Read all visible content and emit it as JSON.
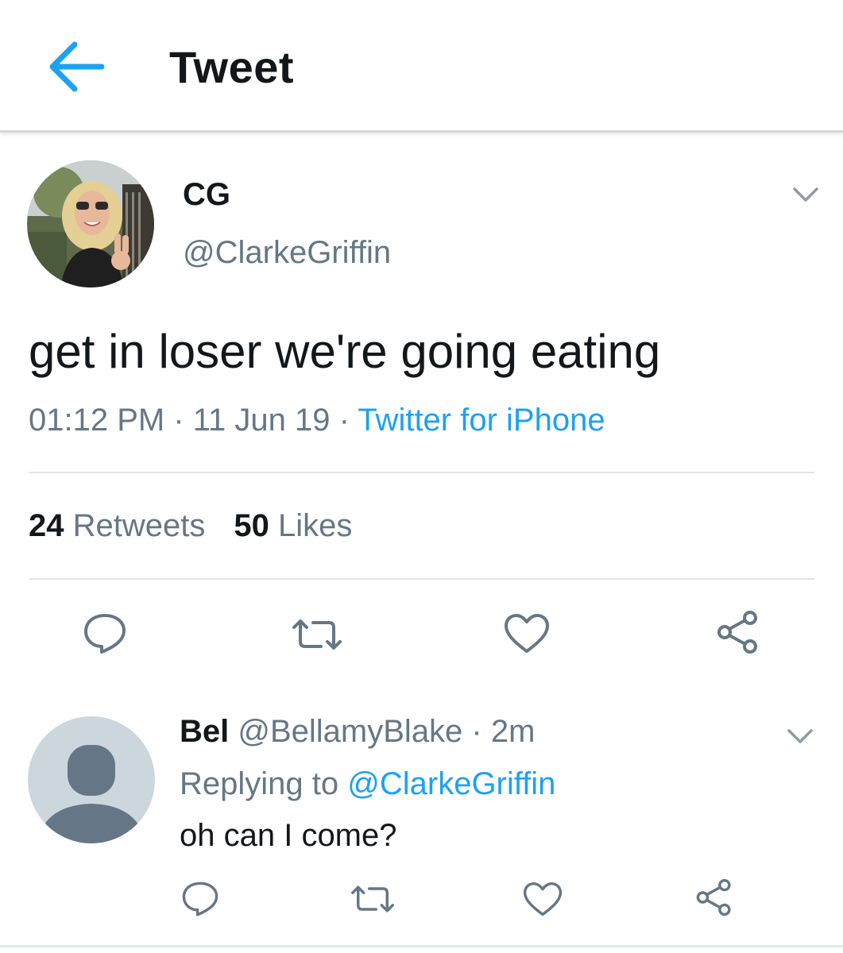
{
  "header": {
    "title": "Tweet"
  },
  "tweet": {
    "author_name": "CG",
    "author_handle": "@ClarkeGriffin",
    "text": "get in loser we're going eating",
    "time": "01:12 PM",
    "date": "11 Jun 19",
    "separator": " · ",
    "source": "Twitter for iPhone",
    "retweets_count": "24",
    "retweets_label": "Retweets",
    "likes_count": "50",
    "likes_label": "Likes"
  },
  "reply": {
    "author_name": "Bel",
    "author_handle": "@BellamyBlake",
    "time_sep": " · ",
    "time": "2m",
    "replying_prefix": "Replying to",
    "replying_to": "@ClarkeGriffin",
    "text": "oh can I come?"
  },
  "icons": {
    "back": "arrow-left-icon",
    "caret": "chevron-down-icon",
    "reply": "reply-bubble-icon",
    "retweet": "retweet-icon",
    "like": "heart-icon",
    "share": "share-icon"
  },
  "colors": {
    "accent": "#1da1f2",
    "secondary_text": "#657786",
    "icon_gray": "#657786",
    "divider": "#e1e4e7"
  }
}
